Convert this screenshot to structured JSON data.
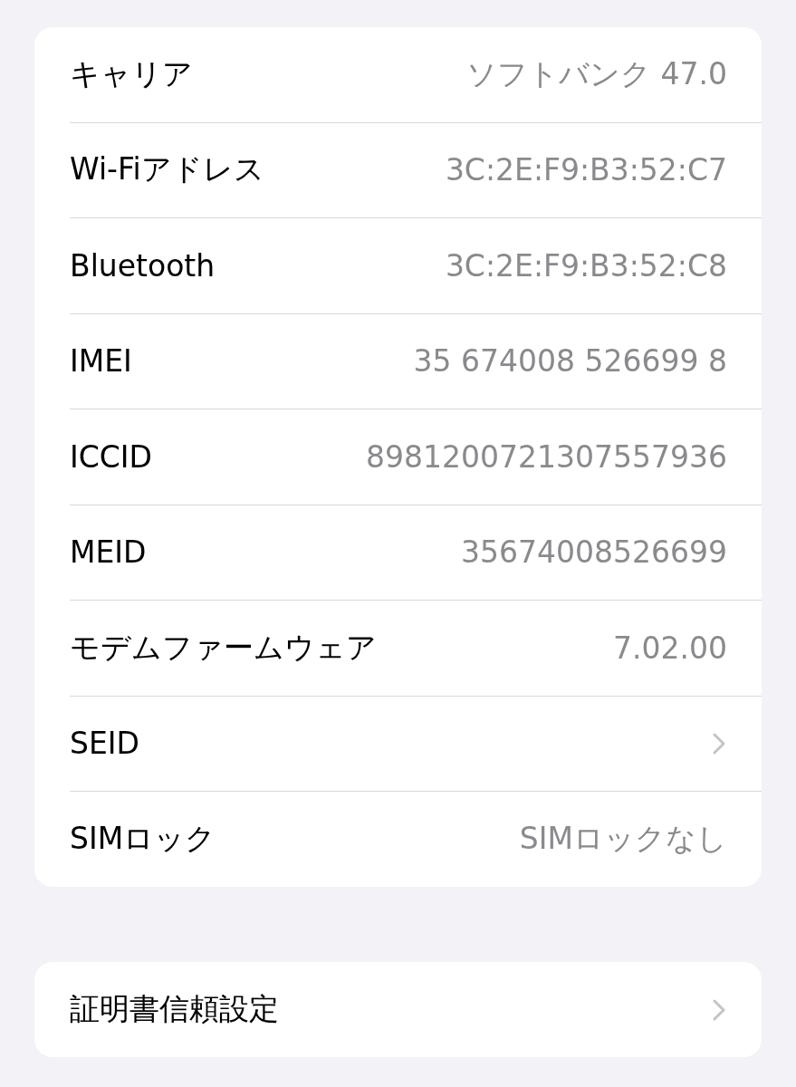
{
  "groups": [
    {
      "rows": [
        {
          "kind": "value",
          "label": "キャリア",
          "value": "ソフトバンク 47.0"
        },
        {
          "kind": "value",
          "label": "Wi-Fiアドレス",
          "value": "3C:2E:F9:B3:52:C7"
        },
        {
          "kind": "value",
          "label": "Bluetooth",
          "value": "3C:2E:F9:B3:52:C8"
        },
        {
          "kind": "value",
          "label": "IMEI",
          "value": "35 674008 526699 8"
        },
        {
          "kind": "value",
          "label": "ICCID",
          "value": "8981200721307557936"
        },
        {
          "kind": "value",
          "label": "MEID",
          "value": "35674008526699"
        },
        {
          "kind": "value",
          "label": "モデムファームウェア",
          "value": "7.02.00"
        },
        {
          "kind": "link",
          "label": "SEID"
        },
        {
          "kind": "value",
          "label": "SIMロック",
          "value": "SIMロックなし"
        }
      ]
    },
    {
      "rows": [
        {
          "kind": "link",
          "label": "証明書信頼設定"
        }
      ]
    }
  ]
}
